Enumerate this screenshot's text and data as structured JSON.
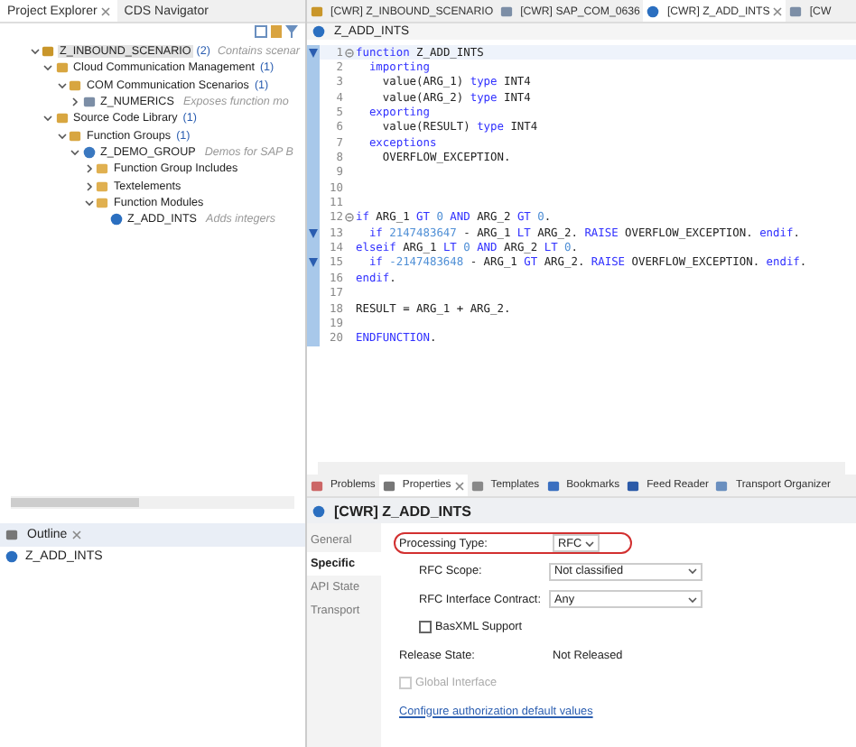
{
  "left_tabs": [
    {
      "label": "Project Explorer",
      "selected": true,
      "closable": true
    },
    {
      "label": "CDS Navigator",
      "selected": false,
      "closable": false
    }
  ],
  "tree": [
    {
      "label": "Z_INBOUND_SCENARIO",
      "count": "(2)",
      "description": "Contains scenar",
      "kind": "package",
      "expanded": true,
      "selected": true,
      "children": [
        {
          "label": "Cloud Communication Management",
          "count": "(1)",
          "kind": "folder-pkg",
          "expanded": true,
          "selected": false,
          "children": [
            {
              "label": "COM Communication Scenarios",
              "count": "(1)",
              "kind": "folder-pkg",
              "expanded": true,
              "selected": false,
              "children": [
                {
                  "label": "Z_NUMERICS",
                  "description": "Exposes function mo",
                  "kind": "scenario",
                  "expanded": false,
                  "selected": false
                }
              ]
            }
          ]
        },
        {
          "label": "Source Code Library",
          "count": "(1)",
          "kind": "folder-pkg",
          "expanded": true,
          "selected": false,
          "children": [
            {
              "label": "Function Groups",
              "count": "(1)",
              "kind": "folder-pkg",
              "expanded": true,
              "selected": false,
              "children": [
                {
                  "label": "Z_DEMO_GROUP",
                  "description": "Demos for SAP B",
                  "kind": "function-group",
                  "expanded": true,
                  "selected": false,
                  "children": [
                    {
                      "label": "Function Group Includes",
                      "kind": "folder",
                      "expanded": false,
                      "selected": false
                    },
                    {
                      "label": "Textelements",
                      "kind": "folder",
                      "expanded": false,
                      "selected": false
                    },
                    {
                      "label": "Function Modules",
                      "kind": "folder",
                      "expanded": true,
                      "selected": false,
                      "children": [
                        {
                          "label": "Z_ADD_INTS",
                          "description": "Adds integers",
                          "kind": "function-module",
                          "selected": false
                        }
                      ]
                    }
                  ]
                }
              ]
            }
          ]
        }
      ]
    }
  ],
  "outline": {
    "tab": "Outline",
    "item": "Z_ADD_INTS"
  },
  "editor_tabs": [
    {
      "label": "[CWR] Z_INBOUND_SCENARIO",
      "kind": "package",
      "selected": false,
      "closable": false
    },
    {
      "label": "[CWR] SAP_COM_0636",
      "kind": "scenario",
      "selected": false,
      "closable": false
    },
    {
      "label": "[CWR] Z_ADD_INTS",
      "kind": "function-module",
      "selected": true,
      "closable": true
    },
    {
      "label": "[CW",
      "kind": "scenario",
      "selected": false,
      "closable": false
    }
  ],
  "breadcrumb": "Z_ADD_INTS",
  "code": [
    {
      "n": "1",
      "marker": true,
      "fold": true,
      "tokens": [
        {
          "text": "function",
          "kind": "kw"
        },
        {
          "text": " Z_ADD_INTS",
          "kind": "plain"
        }
      ]
    },
    {
      "n": "2",
      "marker": false,
      "fold": false,
      "tokens": [
        {
          "text": "  importing",
          "kind": "kw"
        }
      ]
    },
    {
      "n": "3",
      "marker": false,
      "fold": false,
      "tokens": [
        {
          "text": "    value(ARG_1) ",
          "kind": "plain"
        },
        {
          "text": "type",
          "kind": "kw"
        },
        {
          "text": " INT4",
          "kind": "plain"
        }
      ]
    },
    {
      "n": "4",
      "marker": false,
      "fold": false,
      "tokens": [
        {
          "text": "    value(ARG_2) ",
          "kind": "plain"
        },
        {
          "text": "type",
          "kind": "kw"
        },
        {
          "text": " INT4",
          "kind": "plain"
        }
      ]
    },
    {
      "n": "5",
      "marker": false,
      "fold": false,
      "tokens": [
        {
          "text": "  exporting",
          "kind": "kw"
        }
      ]
    },
    {
      "n": "6",
      "marker": false,
      "fold": false,
      "tokens": [
        {
          "text": "    value(RESULT) ",
          "kind": "plain"
        },
        {
          "text": "type",
          "kind": "kw"
        },
        {
          "text": " INT4",
          "kind": "plain"
        }
      ]
    },
    {
      "n": "7",
      "marker": false,
      "fold": false,
      "tokens": [
        {
          "text": "  exceptions",
          "kind": "kw"
        }
      ]
    },
    {
      "n": "8",
      "marker": false,
      "fold": false,
      "tokens": [
        {
          "text": "    OVERFLOW_EXCEPTION.",
          "kind": "plain"
        }
      ]
    },
    {
      "n": "9",
      "marker": false,
      "fold": false
    },
    {
      "n": "10",
      "marker": false,
      "fold": false
    },
    {
      "n": "11",
      "marker": false,
      "fold": false
    },
    {
      "n": "12",
      "marker": false,
      "fold": true,
      "tokens": [
        {
          "text": "if",
          "kind": "kw"
        },
        {
          "text": " ARG_1 ",
          "kind": "plain"
        },
        {
          "text": "GT ",
          "kind": "kw"
        },
        {
          "text": "0",
          "kind": "num"
        },
        {
          "text": " AND",
          "kind": "kw"
        },
        {
          "text": " ARG_2 ",
          "kind": "plain"
        },
        {
          "text": "GT ",
          "kind": "kw"
        },
        {
          "text": "0",
          "kind": "num"
        },
        {
          "text": ".",
          "kind": "plain"
        }
      ]
    },
    {
      "n": "13",
      "marker": true,
      "fold": false,
      "tokens": [
        {
          "text": "  if",
          "kind": "kw"
        },
        {
          "text": " 2147483647",
          "kind": "num"
        },
        {
          "text": " - ARG_1 ",
          "kind": "plain"
        },
        {
          "text": "LT",
          "kind": "kw"
        },
        {
          "text": " ARG_2. ",
          "kind": "plain"
        },
        {
          "text": "RAISE",
          "kind": "kw"
        },
        {
          "text": " OVERFLOW_EXCEPTION. ",
          "kind": "plain"
        },
        {
          "text": "endif",
          "kind": "kw"
        },
        {
          "text": ".",
          "kind": "plain"
        }
      ]
    },
    {
      "n": "14",
      "marker": false,
      "fold": false,
      "tokens": [
        {
          "text": "elseif",
          "kind": "kw"
        },
        {
          "text": " ARG_1 ",
          "kind": "plain"
        },
        {
          "text": "LT ",
          "kind": "kw"
        },
        {
          "text": "0",
          "kind": "num"
        },
        {
          "text": " AND",
          "kind": "kw"
        },
        {
          "text": " ARG_2 ",
          "kind": "plain"
        },
        {
          "text": "LT ",
          "kind": "kw"
        },
        {
          "text": "0",
          "kind": "num"
        },
        {
          "text": ".",
          "kind": "plain"
        }
      ]
    },
    {
      "n": "15",
      "marker": true,
      "fold": false,
      "tokens": [
        {
          "text": "  if",
          "kind": "kw"
        },
        {
          "text": " -2147483648",
          "kind": "num"
        },
        {
          "text": " - ARG_1 ",
          "kind": "plain"
        },
        {
          "text": "GT",
          "kind": "kw"
        },
        {
          "text": " ARG_2. ",
          "kind": "plain"
        },
        {
          "text": "RAISE",
          "kind": "kw"
        },
        {
          "text": " OVERFLOW_EXCEPTION. ",
          "kind": "plain"
        },
        {
          "text": "endif",
          "kind": "kw"
        },
        {
          "text": ".",
          "kind": "plain"
        }
      ]
    },
    {
      "n": "16",
      "marker": false,
      "fold": false,
      "tokens": [
        {
          "text": "endif",
          "kind": "kw"
        },
        {
          "text": ".",
          "kind": "plain"
        }
      ]
    },
    {
      "n": "17",
      "marker": false,
      "fold": false
    },
    {
      "n": "18",
      "marker": false,
      "fold": false,
      "tokens": [
        {
          "text": "RESULT = ARG_1 + ARG_2.",
          "kind": "plain"
        }
      ]
    },
    {
      "n": "19",
      "marker": false,
      "fold": false
    },
    {
      "n": "20",
      "marker": false,
      "fold": false,
      "tokens": [
        {
          "text": "ENDFUNCTION",
          "kind": "kw"
        },
        {
          "text": ".",
          "kind": "plain"
        }
      ]
    }
  ],
  "bottom_tabs": [
    {
      "label": "Problems",
      "kind": "problems",
      "selected": false,
      "closable": false
    },
    {
      "label": "Properties",
      "kind": "properties",
      "selected": true,
      "closable": true
    },
    {
      "label": "Templates",
      "kind": "templates",
      "selected": false,
      "closable": false
    },
    {
      "label": "Bookmarks",
      "kind": "bookmarks",
      "selected": false,
      "closable": false
    },
    {
      "label": "Feed Reader",
      "kind": "feed",
      "selected": false,
      "closable": false
    },
    {
      "label": "Transport Organizer",
      "kind": "transport",
      "selected": false,
      "closable": false
    }
  ],
  "properties": {
    "title": "[CWR] Z_ADD_INTS",
    "sections": [
      {
        "label": "General",
        "selected": false
      },
      {
        "label": "Specific",
        "selected": true
      },
      {
        "label": "API State",
        "selected": false
      },
      {
        "label": "Transport",
        "selected": false
      }
    ],
    "fields": [
      {
        "kind": "select",
        "label": "Processing Type:",
        "value": "RFC",
        "indented": false,
        "highlighted": true
      },
      {
        "kind": "select",
        "label": "RFC Scope:",
        "value": "Not classified",
        "indented": true,
        "highlighted": false
      },
      {
        "kind": "select",
        "label": "RFC Interface Contract:",
        "value": "Any",
        "indented": true,
        "highlighted": false
      },
      {
        "kind": "checkbox",
        "label": "BasXML Support",
        "checked": false,
        "indented": true,
        "disabled": false
      },
      {
        "kind": "text",
        "label": "Release State:",
        "value": "Not Released",
        "indented": false
      },
      {
        "kind": "checkbox",
        "label": "Global Interface",
        "checked": false,
        "indented": false,
        "disabled": true
      },
      {
        "kind": "link",
        "label": "Configure authorization default values",
        "indented": false
      }
    ]
  }
}
